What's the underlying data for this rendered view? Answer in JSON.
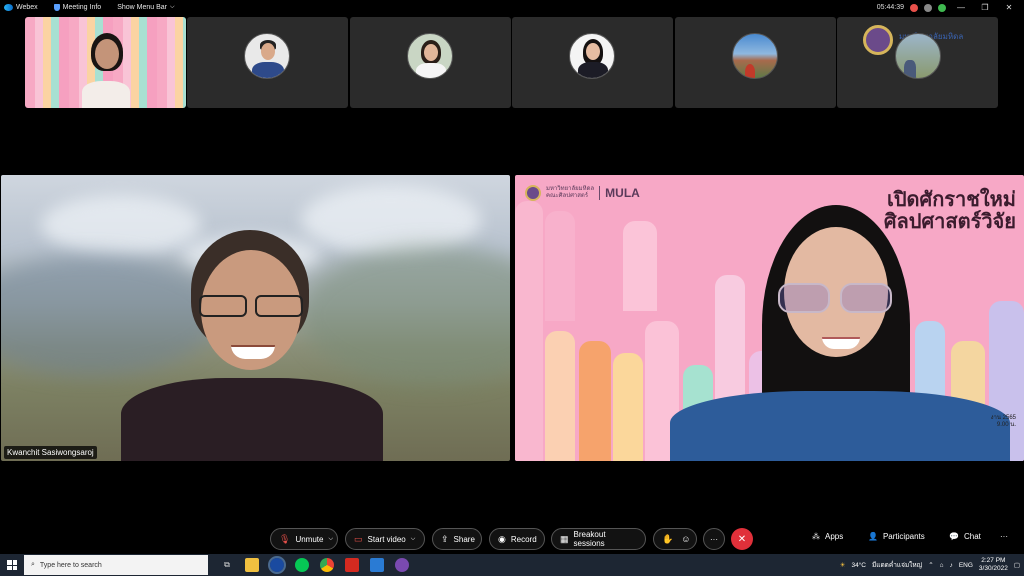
{
  "titlebar": {
    "app_name": "Webex",
    "meeting_info": "Meeting Info",
    "show_menu_bar": "Show Menu Bar",
    "time": "05:44:39",
    "minimize": "—",
    "restore": "❐",
    "close": "✕"
  },
  "filmstrip": {
    "thumb6_logo": "มหาวิทยาลัยมหิดล"
  },
  "main": {
    "left_participant": "Kwanchit Sasiwongsaroj",
    "right_slide": {
      "logo_thai": "มหาวิทยาลัยมหิดล",
      "logo_thai2": "คณะศิลปศาสตร์",
      "logo_brand": "MULA",
      "title_line1": "เปิดศักราชใหม่",
      "title_line2": "ศิลปศาสตร์วิจัย",
      "small1": "งาน 2565",
      "small2": "9.00 น."
    }
  },
  "controls": {
    "unmute": "Unmute",
    "start_video": "Start video",
    "share": "Share",
    "record": "Record",
    "breakout": "Breakout sessions",
    "more": "···",
    "apps": "Apps",
    "participants": "Participants",
    "chat": "Chat",
    "overflow": "···"
  },
  "taskbar": {
    "search_placeholder": "Type here to search",
    "weather": "34°C",
    "weather_text": "มีแดดค่ำแจ่มใหญ่",
    "lang": "ENG",
    "time": "2:27 PM",
    "date": "3/30/2022"
  },
  "colors": {
    "end_call": "#e0303a",
    "taskbar": "#1d2633",
    "record_red": "#e8504a"
  }
}
